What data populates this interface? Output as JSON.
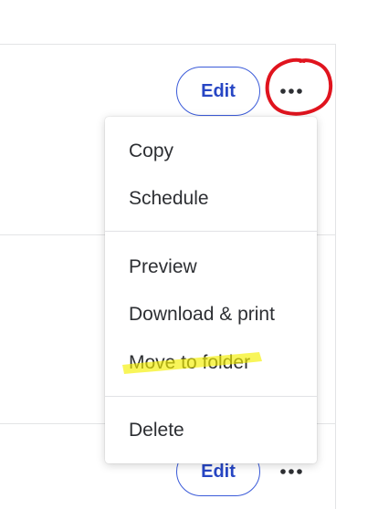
{
  "rows": [
    {
      "edit_label": "Edit",
      "more_label": "More options"
    },
    {
      "edit_label": "Edit",
      "more_label": "More options"
    }
  ],
  "menu": {
    "sections": [
      {
        "items": [
          {
            "label": "Copy"
          },
          {
            "label": "Schedule"
          }
        ]
      },
      {
        "items": [
          {
            "label": "Preview"
          },
          {
            "label": "Download & print"
          },
          {
            "label": "Move to folder"
          }
        ]
      },
      {
        "items": [
          {
            "label": "Delete"
          }
        ]
      }
    ]
  },
  "annotations": {
    "circle_color": "#e0141e",
    "highlight_color": "#f5f000"
  },
  "colors": {
    "accent": "#2746c4",
    "text": "#2d2f33",
    "divider": "#e3e4e6"
  },
  "icons": {
    "more": "more-horizontal-icon"
  }
}
